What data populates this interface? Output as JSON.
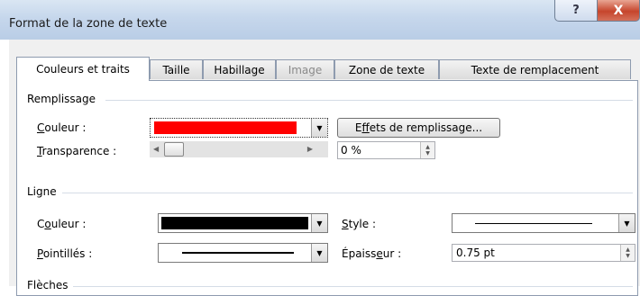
{
  "window": {
    "title": "Format de la zone de texte",
    "help_glyph": "?",
    "close_glyph": "X"
  },
  "tabs": [
    {
      "label": "Couleurs et traits",
      "state": "active"
    },
    {
      "label": "Taille",
      "state": "normal"
    },
    {
      "label": "Habillage",
      "state": "normal"
    },
    {
      "label": "Image",
      "state": "disabled"
    },
    {
      "label": "Zone de texte",
      "state": "normal"
    },
    {
      "label": "Texte de remplacement",
      "state": "normal"
    }
  ],
  "fill": {
    "section": "Remplissage",
    "color_label_u": "C",
    "color_label_rest": "ouleur :",
    "color_value": "#ff0000",
    "effects_pre": "E",
    "effects_u": "f",
    "effects_post": "fets de remplissage...",
    "transparency_label_u": "T",
    "transparency_label_rest": "ransparence :",
    "transparency_value": "0 %",
    "transparency_level": 0
  },
  "line": {
    "section": "Ligne",
    "color_label_pre": "C",
    "color_label_u": "o",
    "color_label_post": "uleur :",
    "color_value": "#000000",
    "dash_label_u": "P",
    "dash_label_rest": "ointillés :",
    "style_label_u": "S",
    "style_label_rest": "tyle :",
    "weight_label_pre": "Épaiss",
    "weight_label_u": "e",
    "weight_label_post": "ur :",
    "weight_value": "0.75 pt"
  },
  "arrows": {
    "section": "Flèches"
  },
  "icons": {
    "dropdown": "dropdown-arrow-icon",
    "left": "scroll-left-icon",
    "right": "scroll-right-icon",
    "spin": "spin-updown-icon"
  }
}
